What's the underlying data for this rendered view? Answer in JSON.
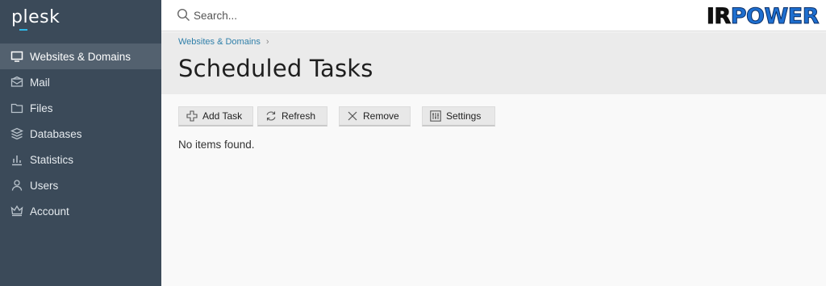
{
  "sidebar": {
    "logo": "plesk",
    "items": [
      {
        "label": "Websites & Domains",
        "icon": "monitor-icon",
        "active": true
      },
      {
        "label": "Mail",
        "icon": "mail-icon",
        "active": false
      },
      {
        "label": "Files",
        "icon": "folder-icon",
        "active": false
      },
      {
        "label": "Databases",
        "icon": "database-icon",
        "active": false
      },
      {
        "label": "Statistics",
        "icon": "bar-chart-icon",
        "active": false
      },
      {
        "label": "Users",
        "icon": "user-icon",
        "active": false
      },
      {
        "label": "Account",
        "icon": "crown-icon",
        "active": false
      }
    ]
  },
  "topbar": {
    "search": {
      "placeholder": "Search...",
      "value": ""
    },
    "brand": {
      "part1": "IR",
      "part2": "POWER"
    }
  },
  "header": {
    "breadcrumb": {
      "item": "Websites & Domains",
      "separator": "›"
    },
    "title": "Scheduled Tasks"
  },
  "toolbar": {
    "add_task": "Add Task",
    "refresh": "Refresh",
    "remove": "Remove",
    "settings": "Settings"
  },
  "list": {
    "empty_message": "No items found."
  },
  "colors": {
    "sidebar_bg": "#3b4a59",
    "sidebar_active": "#53616f",
    "link": "#2f7fa9",
    "header_bg": "#ebebeb",
    "brand_blue": "#1e6fd0"
  }
}
